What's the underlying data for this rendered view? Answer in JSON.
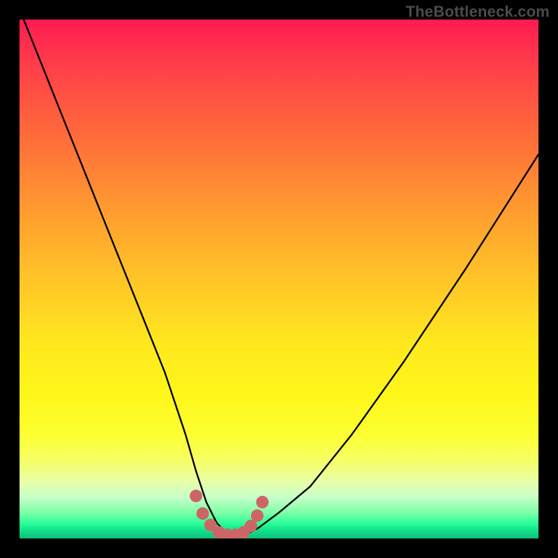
{
  "watermark": "TheBottleneck.com",
  "chart_data": {
    "type": "line",
    "title": "",
    "xlabel": "",
    "ylabel": "",
    "xlim": [
      0,
      100
    ],
    "ylim": [
      0,
      100
    ],
    "series": [
      {
        "name": "bottleneck-curve",
        "x": [
          0,
          4,
          8,
          12,
          16,
          20,
          24,
          28,
          32,
          34,
          36,
          38,
          40,
          42,
          44,
          46,
          50,
          56,
          64,
          74,
          86,
          100
        ],
        "values": [
          102,
          92,
          82,
          72,
          62,
          52,
          42,
          32,
          20,
          13,
          7,
          3,
          1,
          1,
          1,
          2,
          5,
          10,
          20,
          34,
          52,
          74
        ]
      }
    ],
    "markers": {
      "name": "valley-dots",
      "color": "#cc6666",
      "x": [
        34.0,
        35.3,
        36.8,
        38.4,
        40.0,
        41.6,
        43.2,
        44.6,
        45.8,
        46.8
      ],
      "values": [
        8.2,
        4.8,
        2.6,
        1.2,
        0.7,
        0.7,
        1.2,
        2.4,
        4.4,
        7.0
      ]
    },
    "gradient_stops": [
      {
        "pos": 0.0,
        "color": "#ff1a52"
      },
      {
        "pos": 0.5,
        "color": "#ffc427"
      },
      {
        "pos": 0.8,
        "color": "#fcff30"
      },
      {
        "pos": 0.95,
        "color": "#7effa8"
      },
      {
        "pos": 1.0,
        "color": "#0fbf78"
      }
    ]
  }
}
